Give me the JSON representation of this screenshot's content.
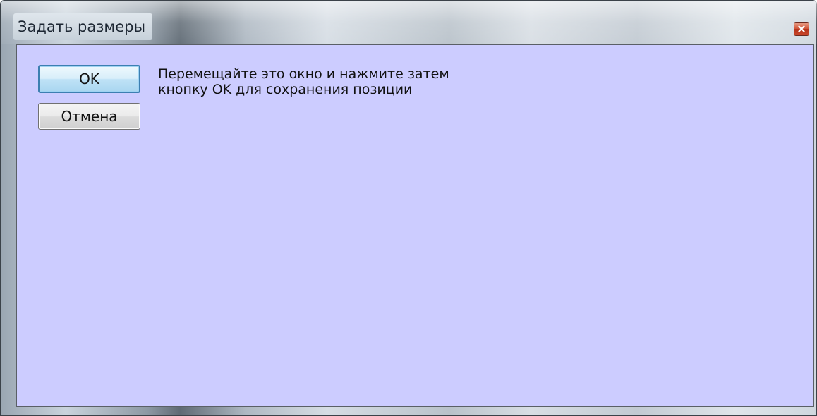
{
  "window": {
    "title": "Задать размеры",
    "close_icon": "close-icon"
  },
  "dialog": {
    "ok_label": "OK",
    "cancel_label": "Отмена",
    "message_line1": "Перемещайте это окно и нажмите затем",
    "message_line2": "кнопку OK для сохранения позиции"
  },
  "colors": {
    "client_background": "#ccccff",
    "ok_border": "#3c7fb1",
    "close_button": "#c9472b"
  }
}
